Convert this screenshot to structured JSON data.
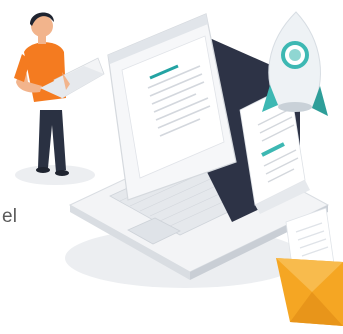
{
  "text_fragment": "el",
  "colors": {
    "shirt": "#f47b20",
    "pants": "#2a3142",
    "skin": "#f2b48c",
    "hair": "#1f2430",
    "laptop_body": "#eef0f3",
    "laptop_screen_frame": "#2d3346",
    "document_accent": "#23a3a3",
    "rocket_body": "#eef2f5",
    "rocket_accent": "#3db8b3",
    "envelope": "#f5a623",
    "shadow": "#e3e6ea"
  },
  "icons": [
    "person-with-laptop-illustration",
    "laptop-illustration",
    "document-window-illustration",
    "rocket-icon",
    "envelope-icon"
  ]
}
